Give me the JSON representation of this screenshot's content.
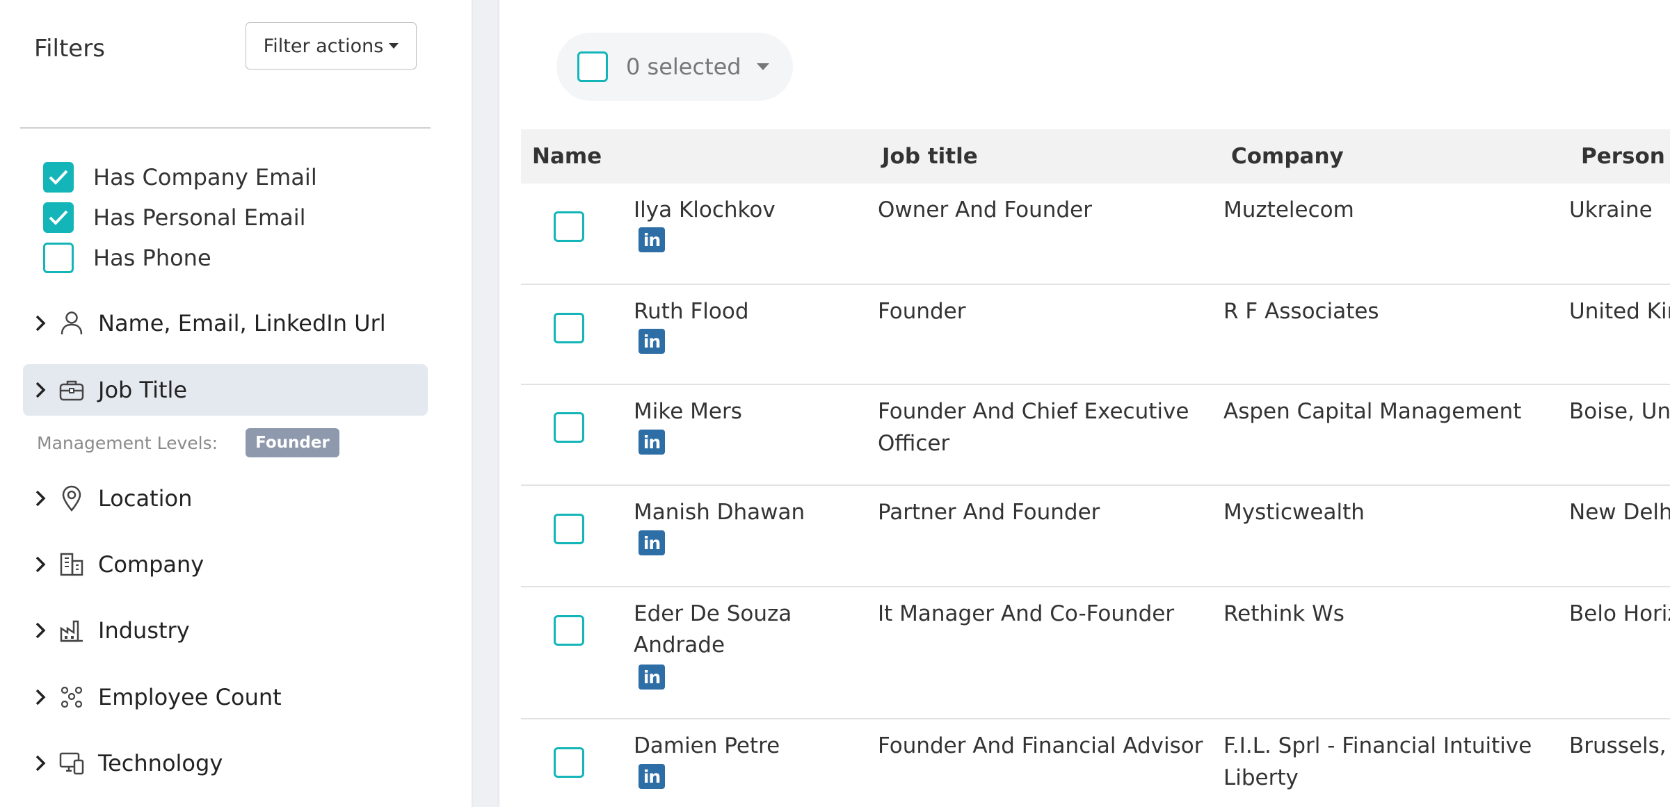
{
  "sidebar": {
    "title": "Filters",
    "filter_actions_label": "Filter actions",
    "checkboxes": [
      {
        "label": "Has Company Email",
        "checked": true
      },
      {
        "label": "Has Personal Email",
        "checked": true
      },
      {
        "label": "Has Phone",
        "checked": false
      }
    ],
    "sections": [
      {
        "label": "Name, Email, LinkedIn Url",
        "icon": "person-icon"
      },
      {
        "label": "Job Title",
        "icon": "briefcase-icon",
        "active": true
      },
      {
        "label": "Location",
        "icon": "location-pin-icon"
      },
      {
        "label": "Company",
        "icon": "building-icon"
      },
      {
        "label": "Industry",
        "icon": "factory-icon"
      },
      {
        "label": "Employee Count",
        "icon": "people-group-icon"
      },
      {
        "label": "Technology",
        "icon": "devices-icon"
      }
    ],
    "management_levels_label": "Management Levels:",
    "management_levels_value": "Founder"
  },
  "selection": {
    "label": "0 selected"
  },
  "table": {
    "headers": [
      "Name",
      "Job title",
      "Company",
      "Person lo"
    ],
    "rows": [
      {
        "name": [
          "Ilya Klochkov"
        ],
        "job": [
          "Owner And Founder"
        ],
        "company": [
          "Muztelecom"
        ],
        "location": "Ukraine"
      },
      {
        "name": [
          "Ruth Flood"
        ],
        "job": [
          "Founder"
        ],
        "company": [
          "R F Associates"
        ],
        "location": "United Kin"
      },
      {
        "name": [
          "Mike Mers"
        ],
        "job": [
          "Founder And Chief Executive",
          "Officer"
        ],
        "company": [
          "Aspen Capital Management"
        ],
        "location": "Boise, Un"
      },
      {
        "name": [
          "Manish Dhawan"
        ],
        "job": [
          "Partner And Founder"
        ],
        "company": [
          "Mysticwealth"
        ],
        "location": "New Delh"
      },
      {
        "name": [
          "Eder De Souza",
          "Andrade"
        ],
        "job": [
          "It Manager And Co-Founder"
        ],
        "company": [
          "Rethink Ws"
        ],
        "location": "Belo Horiz"
      },
      {
        "name": [
          "Damien Petre"
        ],
        "job": [
          "Founder And Financial Advisor"
        ],
        "company": [
          "F.I.L. Sprl - Financial Intuitive",
          "Liberty"
        ],
        "location": "Brussels,"
      }
    ],
    "linkedin_icon_text": "in"
  },
  "colors": {
    "accent": "#13b5b8",
    "linkedin": "#2e6ea6",
    "badge": "#8e99ad",
    "active_row": "#e4e8ef"
  }
}
